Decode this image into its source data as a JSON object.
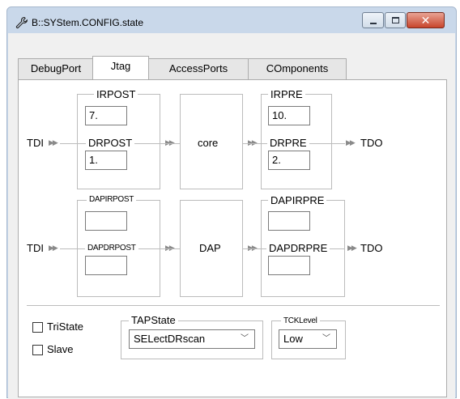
{
  "window": {
    "title": "B::SYStem.CONFIG.state",
    "title_icon": "wrench-icon",
    "minimize_glyph": "minimize-icon",
    "maximize_glyph": "maximize-icon",
    "close_glyph": "✕"
  },
  "tabs": [
    {
      "label": "DebugPort"
    },
    {
      "label": "Jtag"
    },
    {
      "label": "AccessPorts"
    },
    {
      "label": "COmponents"
    }
  ],
  "active_tab": "Jtag",
  "jtag": {
    "tdi": "TDI",
    "tdo": "TDO",
    "arrow": "▶▶",
    "row1": {
      "irpost_label": "IRPOST",
      "irpost_value": "7.",
      "drpost_label": "DRPOST",
      "drpost_value": "1.",
      "core_label": "core",
      "irpre_label": "IRPRE",
      "irpre_value": "10.",
      "drpre_label": "DRPRE",
      "drpre_value": "2."
    },
    "row2": {
      "dapirpost_label": "DAPIRPOST",
      "dapirpost_value": "",
      "dapdrpost_label": "DAPDRPOST",
      "dapdrpost_value": "",
      "dap_label": "DAP",
      "dapirpre_label": "DAPIRPRE",
      "dapirpre_value": "",
      "dapdrpre_label": "DAPDRPRE",
      "dapdrpre_value": ""
    }
  },
  "options": {
    "tristate_label": "TriState",
    "tristate_checked": false,
    "slave_label": "Slave",
    "slave_checked": false,
    "tapstate_label": "TAPState",
    "tapstate_value": "SELectDRscan",
    "tcklevel_label": "TCKLevel",
    "tcklevel_value": "Low",
    "chevron": "﹀"
  }
}
